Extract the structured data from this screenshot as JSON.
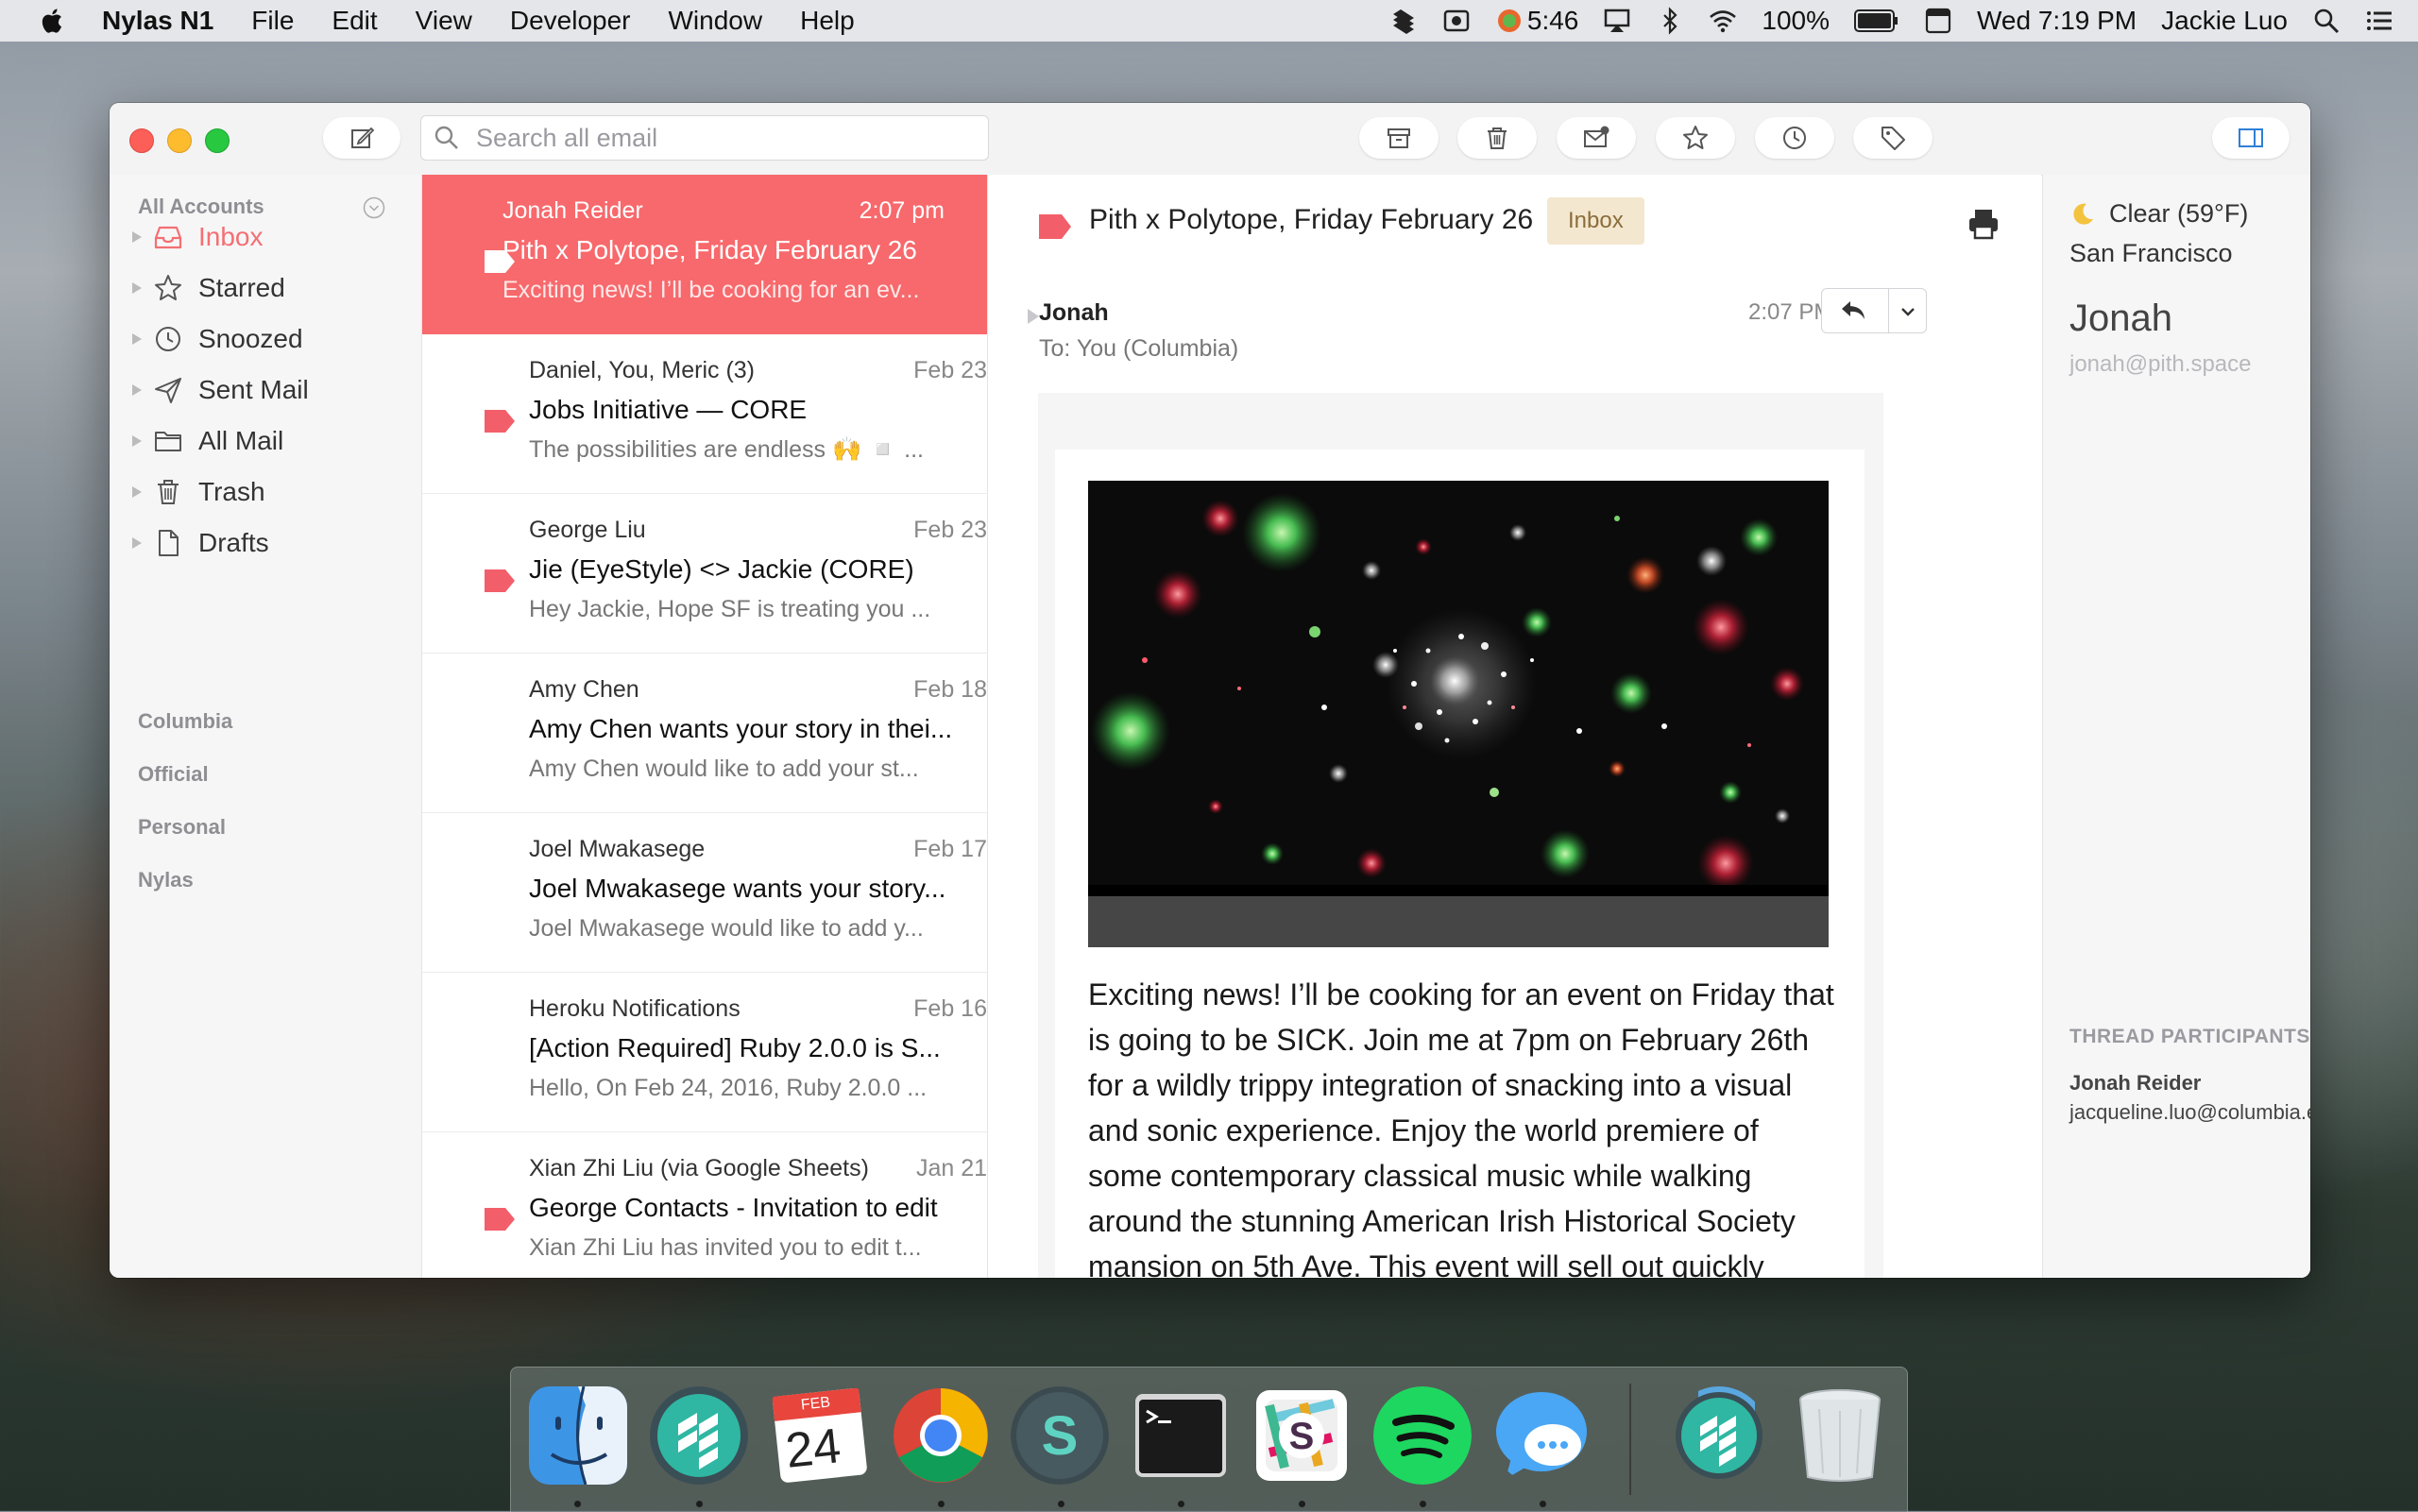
{
  "menubar": {
    "app_name": "Nylas N1",
    "menus": [
      "File",
      "Edit",
      "View",
      "Developer",
      "Window",
      "Help"
    ],
    "timer": "5:46",
    "battery": "100%",
    "clock": "Wed 7:19 PM",
    "user": "Jackie Luo"
  },
  "toolbar": {
    "search_placeholder": "Search all email",
    "buttons": [
      "compose-icon",
      "archive-icon",
      "trash-icon",
      "mark-unread-icon",
      "star-icon",
      "snooze-icon",
      "tag-icon",
      "sidebar-toggle-icon"
    ]
  },
  "sidebar": {
    "header": "All Accounts",
    "items": [
      {
        "label": "Inbox",
        "icon": "inbox-icon",
        "active": true
      },
      {
        "label": "Starred",
        "icon": "star-icon"
      },
      {
        "label": "Snoozed",
        "icon": "clock-icon"
      },
      {
        "label": "Sent Mail",
        "icon": "send-icon"
      },
      {
        "label": "All Mail",
        "icon": "folder-icon"
      },
      {
        "label": "Trash",
        "icon": "trash-icon"
      },
      {
        "label": "Drafts",
        "icon": "draft-icon"
      }
    ],
    "accounts": [
      "Columbia",
      "Official",
      "Personal",
      "Nylas"
    ]
  },
  "threads": [
    {
      "from": "Jonah Reider",
      "date": "2:07 pm",
      "subject": "Pith x Polytope, Friday February 26",
      "snippet": "Exciting news! I’ll be cooking for an ev...",
      "tagged": true,
      "selected": true
    },
    {
      "from": "Daniel, You, Meric (3)",
      "date": "Feb 23",
      "subject": "Jobs Initiative — CORE",
      "snippet": "The possibilities are endless 🙌 ◽ ...",
      "tagged": true
    },
    {
      "from": "George Liu",
      "date": "Feb 23",
      "subject": "Jie (EyeStyle) <> Jackie (CORE)",
      "snippet": "Hey Jackie, Hope SF is treating you ...",
      "tagged": true
    },
    {
      "from": "Amy Chen",
      "date": "Feb 18",
      "subject": "Amy Chen wants your story in thei...",
      "snippet": "Amy Chen would like to add your st...",
      "tagged": false
    },
    {
      "from": "Joel Mwakasege",
      "date": "Feb 17",
      "subject": "Joel Mwakasege wants your story...",
      "snippet": "Joel Mwakasege would like to add y...",
      "tagged": false
    },
    {
      "from": "Heroku Notifications",
      "date": "Feb 16",
      "subject": "[Action Required] Ruby 2.0.0 is S...",
      "snippet": "Hello, On Feb 24, 2016, Ruby 2.0.0 ...",
      "tagged": false
    },
    {
      "from": "Xian Zhi Liu (via Google Sheets)",
      "date": "Jan 21",
      "subject": "George Contacts - Invitation to edit",
      "snippet": "Xian Zhi Liu has invited you to edit t...",
      "tagged": true
    }
  ],
  "message": {
    "subject": "Pith x Polytope, Friday February 26",
    "label": "Inbox",
    "sender": "Jonah",
    "to": "To: You (Columbia)",
    "time": "2:07 PM",
    "body": "Exciting news! I’ll be cooking for an event on Friday that is going to be SICK. Join me at 7pm on February 26th for a wildly trippy integration of snacking into a visual and sonic experience. Enjoy the world premiere of some contemporary classical music while walking around the stunning American Irish Historical Society mansion on 5th Ave. This event will sell out quickly"
  },
  "contact": {
    "weather": "Clear (59°F)",
    "city": "San Francisco",
    "name": "Jonah",
    "email": "jonah@pith.space",
    "participants_header": "THREAD PARTICIPANTS",
    "participant_name": "Jonah Reider",
    "participant_email": "jacqueline.luo@columbia.edu"
  },
  "dock": {
    "apps": [
      "finder-icon",
      "nylas-icon",
      "calendar-icon",
      "chrome-icon",
      "sketch-s-icon",
      "terminal-icon",
      "slack-icon",
      "spotify-icon",
      "messages-icon",
      "nylas-folder-icon",
      "trash-can-icon"
    ],
    "calendar_month": "FEB",
    "calendar_day": "24"
  },
  "colors": {
    "accent": "#f7696c",
    "tag": "#f25f6a",
    "badge_bg": "#f4e7cf"
  }
}
